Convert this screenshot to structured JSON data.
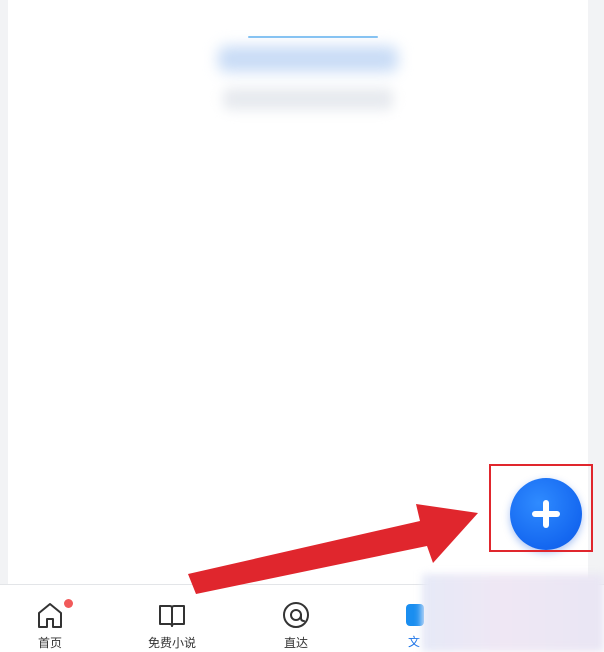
{
  "bottom_nav": {
    "tabs": [
      {
        "label": "首页",
        "icon": "home-icon",
        "has_badge": true
      },
      {
        "label": "免费小说",
        "icon": "book-icon"
      },
      {
        "label": "直达",
        "icon": "at-target-icon"
      },
      {
        "label": "文",
        "icon": "document-icon",
        "active": true
      }
    ]
  },
  "fab": {
    "icon": "plus-icon"
  },
  "annotation": {
    "color": "#e0262d"
  },
  "colors": {
    "accent": "#1a73e8",
    "fab": "#1467f0",
    "badge": "#f15a5a",
    "background": "#f2f3f5"
  }
}
